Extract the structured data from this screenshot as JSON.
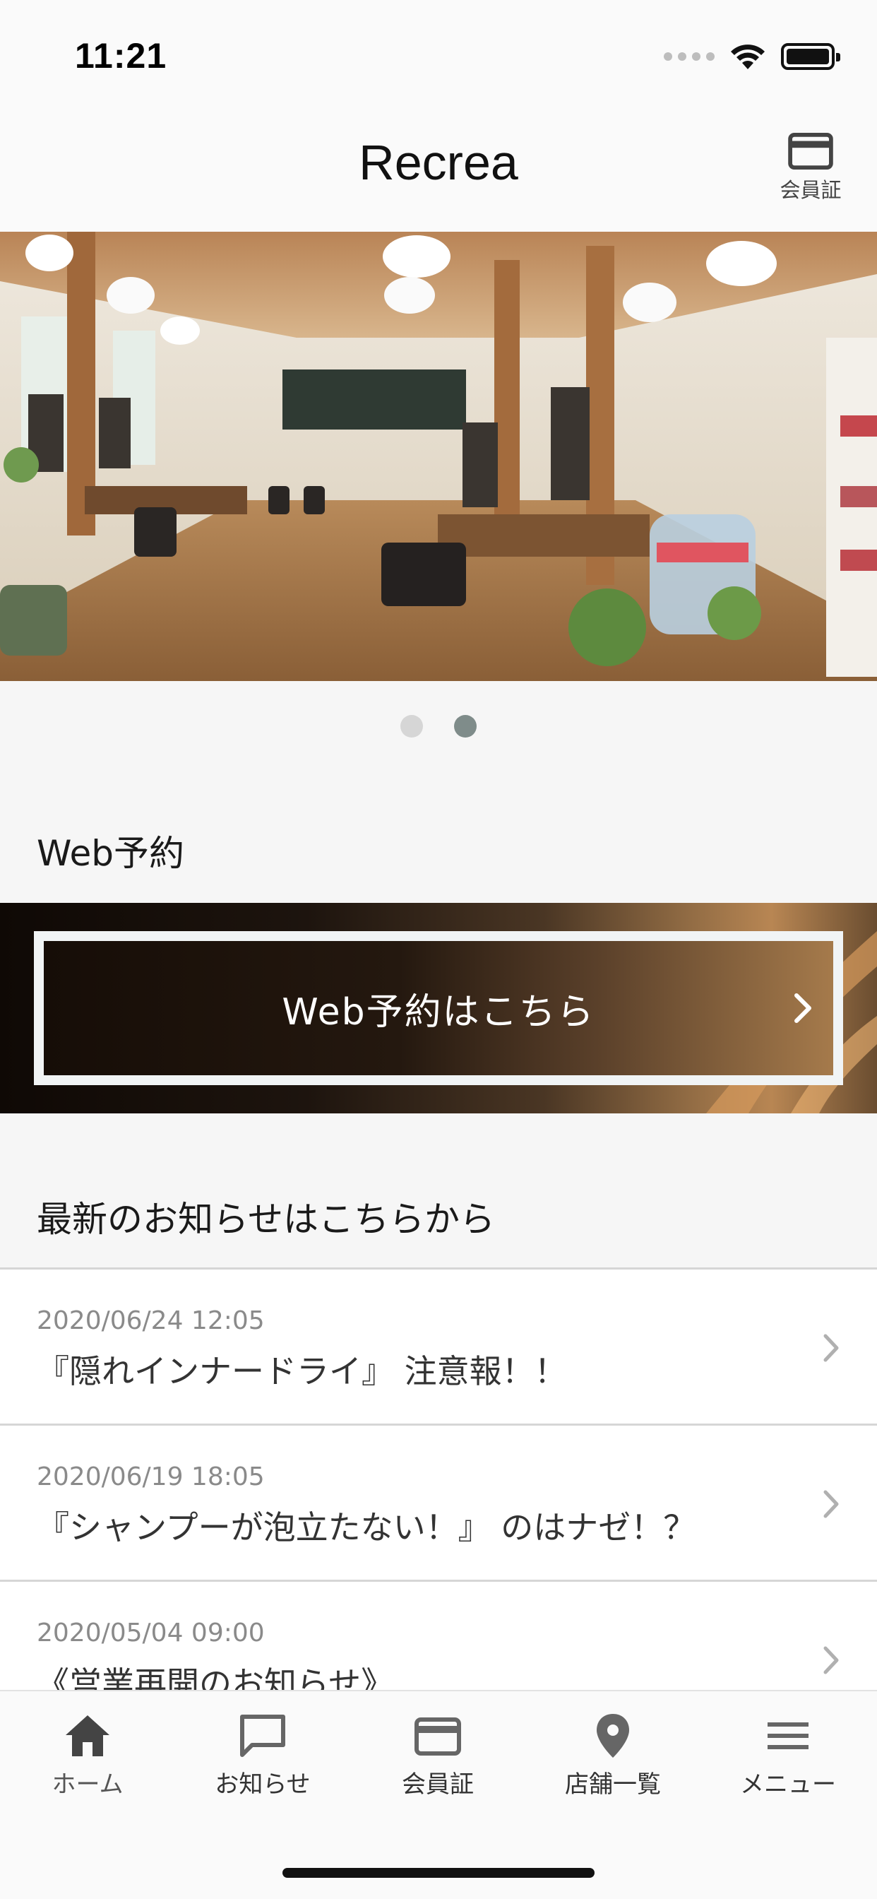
{
  "status_bar": {
    "time": "11:21"
  },
  "header": {
    "title": "Recrea",
    "member_card_label": "会員証"
  },
  "carousel": {
    "page_count": 2,
    "active_index": 1
  },
  "reservation": {
    "section_title": "Web予約",
    "banner_label": "Web予約はこちら"
  },
  "news": {
    "section_title": "最新のお知らせはこちらから",
    "items": [
      {
        "date": "2020/06/24 12:05",
        "title": "『隠れインナードライ』 注意報！！"
      },
      {
        "date": "2020/06/19 18:05",
        "title": "『シャンプーが泡立たない！』 のはナゼ！？"
      },
      {
        "date": "2020/05/04 09:00",
        "title": "《営業再開のお知らせ》"
      }
    ]
  },
  "tab_bar": {
    "tabs": [
      {
        "label": "ホーム",
        "icon": "home-icon"
      },
      {
        "label": "お知らせ",
        "icon": "chat-icon"
      },
      {
        "label": "会員証",
        "icon": "card-icon"
      },
      {
        "label": "店舗一覧",
        "icon": "location-pin-icon"
      },
      {
        "label": "メニュー",
        "icon": "menu-icon"
      }
    ]
  },
  "colors": {
    "icon_gray": "#666666",
    "carousel_active_dot": "#7f8c8a",
    "carousel_inactive_dot": "#d6d6d6"
  }
}
